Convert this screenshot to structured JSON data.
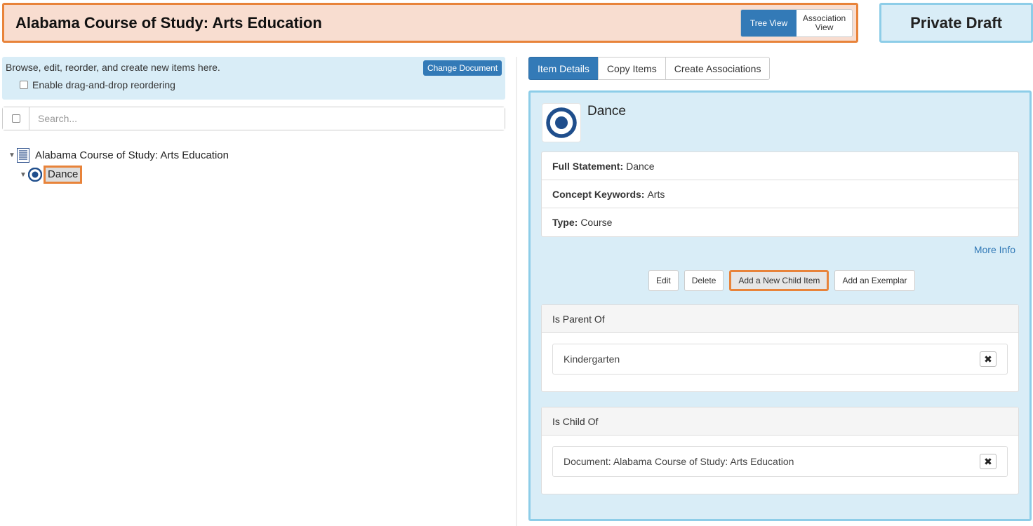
{
  "header": {
    "title": "Alabama Course of Study: Arts Education",
    "views": [
      {
        "label": "Tree View",
        "active": true
      },
      {
        "label": "Association View",
        "active": false
      }
    ],
    "status": "Private Draft"
  },
  "left_panel": {
    "info_text": "Browse, edit, reorder, and create new items here.",
    "change_document_label": "Change Document",
    "drag_drop_label": "Enable drag-and-drop reordering",
    "search_placeholder": "Search...",
    "tree": {
      "root_label": "Alabama Course of Study: Arts Education",
      "child_label": "Dance"
    }
  },
  "right_panel": {
    "tabs": [
      "Item Details",
      "Copy Items",
      "Create Associations"
    ],
    "item": {
      "title": "Dance",
      "properties": [
        {
          "key": "Full Statement:",
          "value": "Dance"
        },
        {
          "key": "Concept Keywords:",
          "value": "Arts"
        },
        {
          "key": "Type:",
          "value": "Course"
        }
      ],
      "more_info": "More Info"
    },
    "actions": [
      "Edit",
      "Delete",
      "Add a New Child Item",
      "Add an Exemplar"
    ],
    "is_parent_of": {
      "heading": "Is Parent Of",
      "item": "Kindergarten"
    },
    "is_child_of": {
      "heading": "Is Child Of",
      "item": "Document: Alabama Course of Study: Arts Education"
    }
  },
  "colors": {
    "accent": "#337ab7",
    "highlight": "#e8833a",
    "info_bg": "#d9edf7",
    "header_bg": "#f8ddd0"
  }
}
